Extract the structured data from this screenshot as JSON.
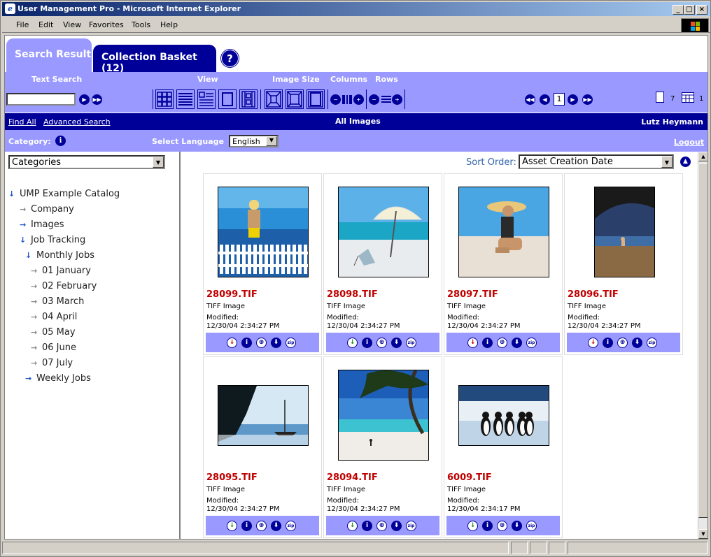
{
  "window": {
    "title": "User Management Pro - Microsoft Internet Explorer"
  },
  "menu": [
    "File",
    "Edit",
    "View",
    "Favorites",
    "Tools",
    "Help"
  ],
  "tabs": {
    "search_result": "Search Result",
    "collection_basket": "Collection Basket (12)",
    "help": "?"
  },
  "toolbar": {
    "text_search_label": "Text Search",
    "view_label": "View",
    "image_size_label": "Image Size",
    "columns_label": "Columns",
    "rows_label": "Rows",
    "search_value": "",
    "page": "1",
    "page_count": "7",
    "grid_count": "1"
  },
  "nav": {
    "find_all": "Find All",
    "advanced_search": "Advanced Search",
    "center": "All Images",
    "user": "Lutz Heymann"
  },
  "category_bar": {
    "category_label": "Category:",
    "language_label": "Select Language",
    "language_value": "English",
    "logout": "Logout"
  },
  "sidebar": {
    "dropdown": "Categories",
    "tree": [
      {
        "label": "UMP Example Catalog",
        "level": 0,
        "arrow": "down"
      },
      {
        "label": "Company",
        "level": 1,
        "arrow": "right-grey"
      },
      {
        "label": "Images",
        "level": 1,
        "arrow": "right-blue"
      },
      {
        "label": "Job Tracking",
        "level": 1,
        "arrow": "down"
      },
      {
        "label": "Monthly Jobs",
        "level": 2,
        "arrow": "down"
      },
      {
        "label": "01 January",
        "level": 3,
        "arrow": "right-grey"
      },
      {
        "label": "02 February",
        "level": 3,
        "arrow": "right-grey"
      },
      {
        "label": "03 March",
        "level": 3,
        "arrow": "right-grey"
      },
      {
        "label": "04 April",
        "level": 3,
        "arrow": "right-grey"
      },
      {
        "label": "05 May",
        "level": 3,
        "arrow": "right-grey"
      },
      {
        "label": "06 June",
        "level": 3,
        "arrow": "right-grey"
      },
      {
        "label": "07 July",
        "level": 3,
        "arrow": "right-grey"
      },
      {
        "label": "Weekly Jobs",
        "level": 2,
        "arrow": "right-blue"
      }
    ]
  },
  "main": {
    "sort_label": "Sort Order:",
    "sort_value": "Asset Creation Date",
    "modified_label": "Modified:",
    "items": [
      {
        "name": "28099.TIF",
        "type": "TIFF Image",
        "modified": "12/30/04 2:34:27 PM",
        "scene": "fence"
      },
      {
        "name": "28098.TIF",
        "type": "TIFF Image",
        "modified": "12/30/04 2:34:27 PM",
        "scene": "umbrella"
      },
      {
        "name": "28097.TIF",
        "type": "TIFF Image",
        "modified": "12/30/04 2:34:27 PM",
        "scene": "hat"
      },
      {
        "name": "28096.TIF",
        "type": "TIFF Image",
        "modified": "12/30/04 2:34:27 PM",
        "scene": "cave"
      },
      {
        "name": "28095.TIF",
        "type": "TIFF Image",
        "modified": "12/30/04 2:34:27 PM",
        "scene": "sailboat"
      },
      {
        "name": "28094.TIF",
        "type": "TIFF Image",
        "modified": "12/30/04 2:34:27 PM",
        "scene": "palm"
      },
      {
        "name": "6009.TIF",
        "type": "TIFF Image",
        "modified": "12/30/04 2:34:17 PM",
        "scene": "penguins"
      }
    ],
    "actions": [
      "download-icon",
      "info-icon",
      "add-basket-icon",
      "down-arrow-icon",
      "zip-icon"
    ]
  },
  "colors": {
    "accent": "#9999ff",
    "dark": "#000099",
    "title_red": "#c00000"
  }
}
